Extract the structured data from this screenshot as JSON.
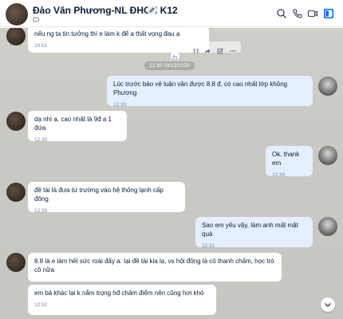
{
  "header": {
    "title": "Đào Văn Phương-NL ĐHCN K12"
  },
  "divider_time": "12:30 03/12/2020",
  "messages": [
    {
      "text": "nếu ng ta tin tưởng thì e làm k để a thất vọng đau ạ",
      "time": "10:51"
    },
    {
      "text": "Lúc trước bảo vệ luận văn được 8.8 đ, có cao nhất lớp không Phương",
      "time": "12:30"
    },
    {
      "text": "dạ nhì ạ, cao nhất là 9đ ạ 1 đứa",
      "time": "12:30"
    },
    {
      "text": "Ok, thank em",
      "time": "12:30"
    },
    {
      "text": "đề tài là đưa từ trường vào hệ thống lạnh cấp đông",
      "time": "12:30"
    },
    {
      "text": "Sao em yếu vậy, làm anh mất mặt quá",
      "time": "12:31"
    },
    {
      "text": "8.8 là e làm hết sức roài đấy a. tại đề tài kia lạ, vs hội đồng là cô thanh chấm, học trò cô nữa",
      "time": ""
    },
    {
      "text": "em bả khác lại k nắm trọng hđ chấm điểm nên cũng hơi khó",
      "time": "12:32"
    }
  ]
}
